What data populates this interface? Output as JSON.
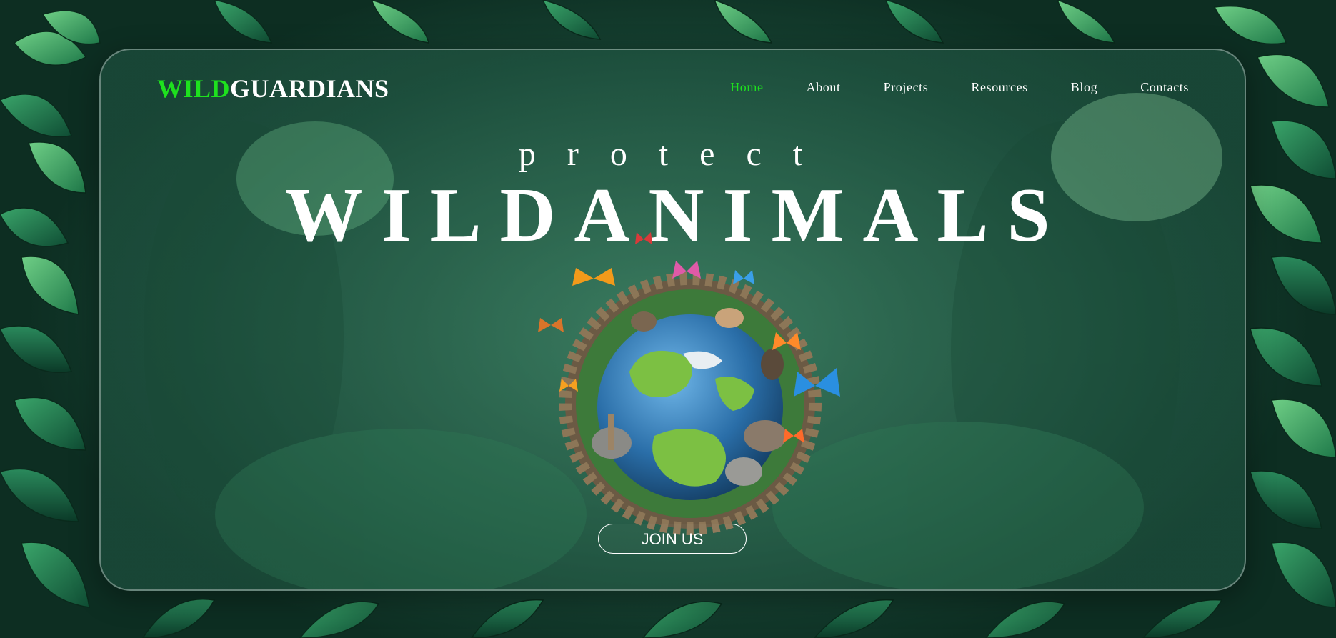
{
  "brand": {
    "logo_accent": "WILD",
    "logo_rest": "GUARDIANS",
    "accent_color": "#1ee11e"
  },
  "nav": {
    "items": [
      {
        "label": "Home",
        "active": true
      },
      {
        "label": "About",
        "active": false
      },
      {
        "label": "Projects",
        "active": false
      },
      {
        "label": "Resources",
        "active": false
      },
      {
        "label": "Blog",
        "active": false
      },
      {
        "label": "Contacts",
        "active": false
      }
    ]
  },
  "hero": {
    "kicker": "protect",
    "headline": "WILDANIMALS",
    "image": "earth-globe-with-animals-and-butterflies",
    "cta_label": "JOIN US"
  },
  "background": {
    "scene": "jungle-leaves",
    "primary_color": "#1c4d3b"
  }
}
